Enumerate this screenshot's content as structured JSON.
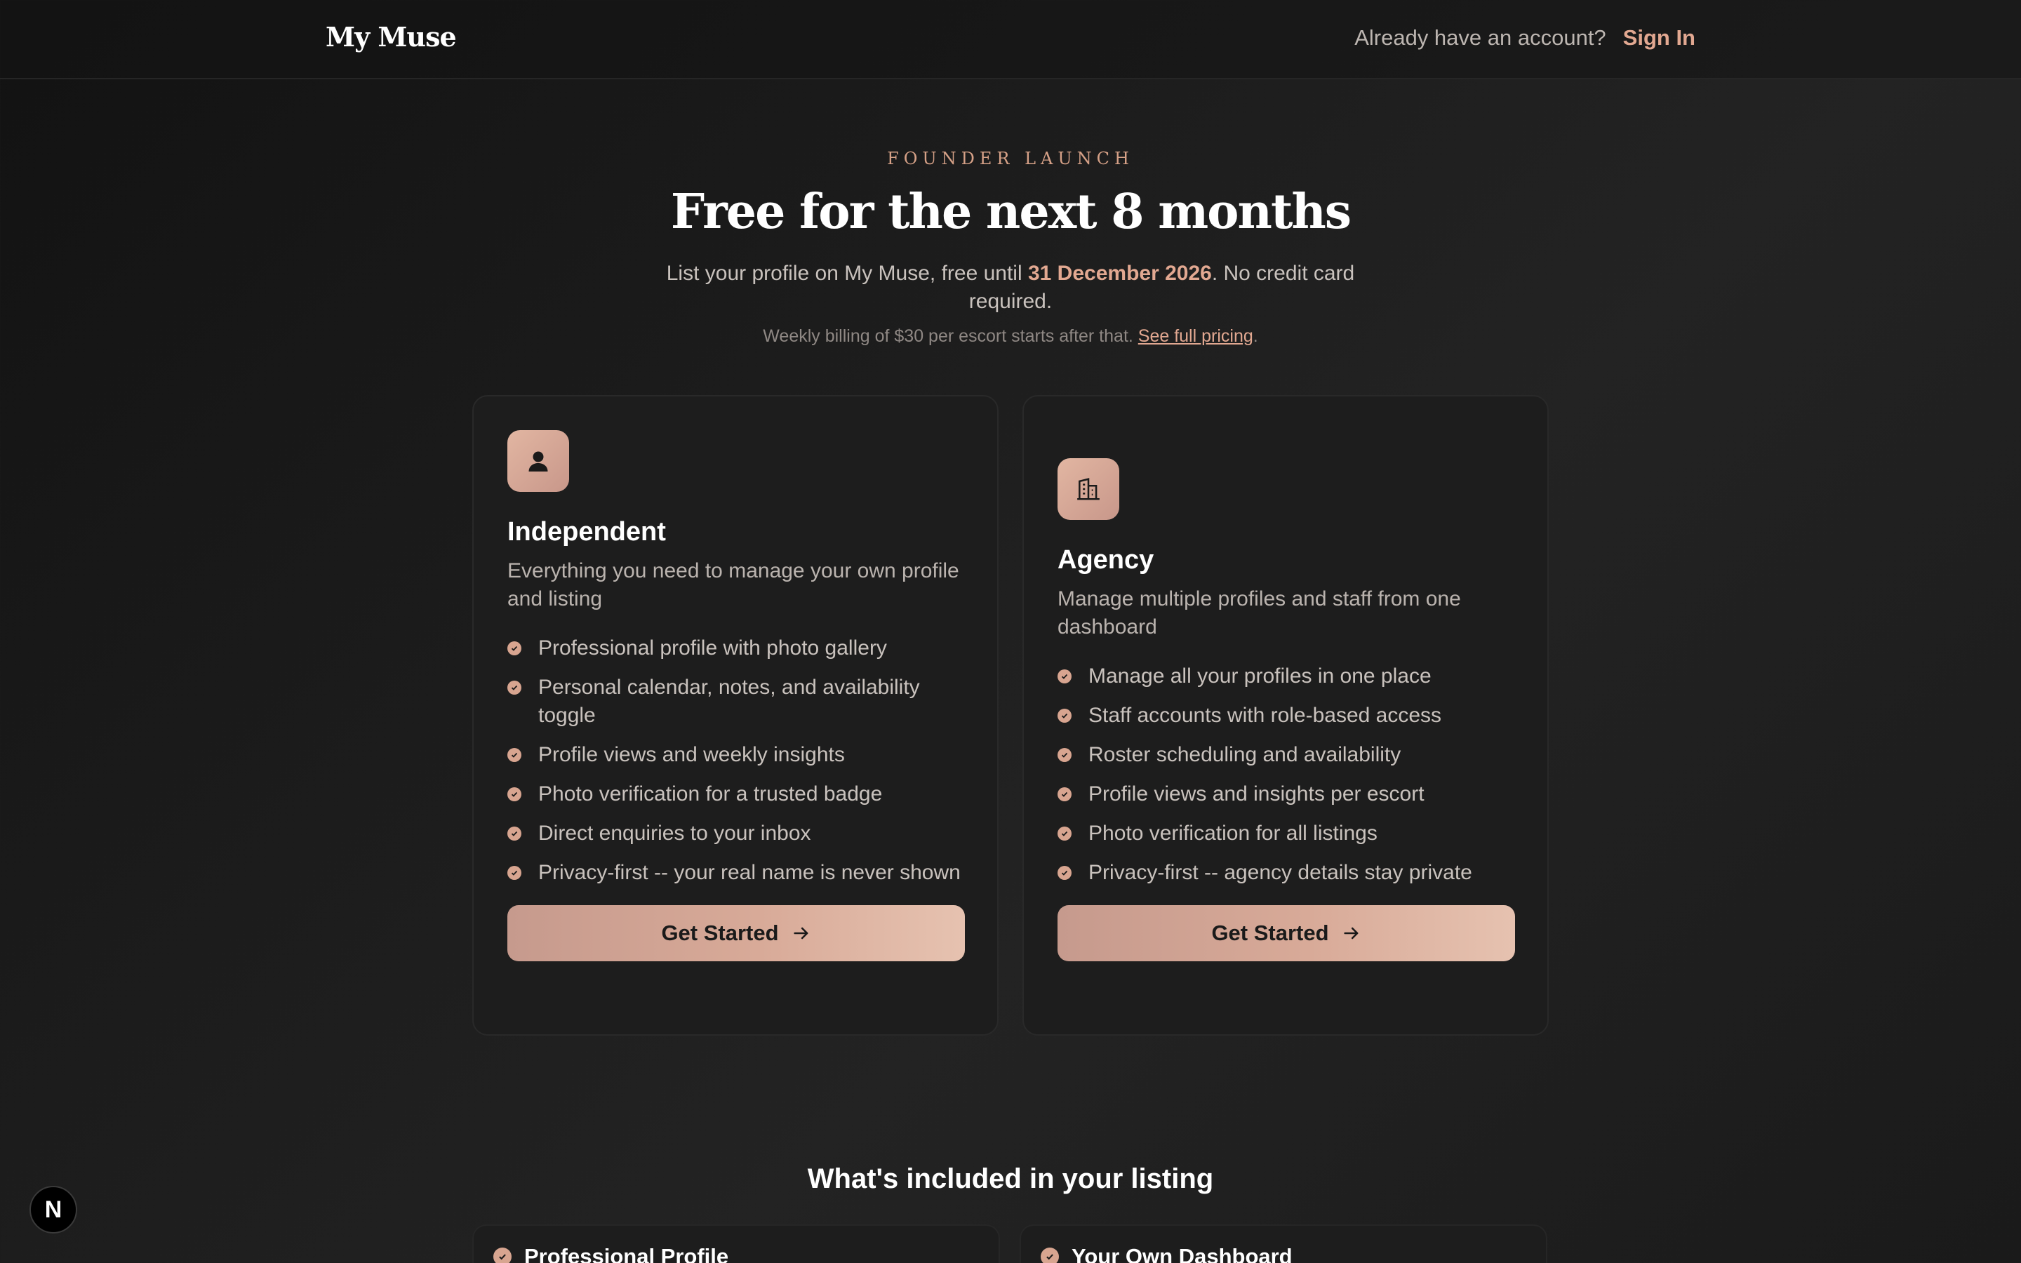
{
  "header": {
    "logo": "My Muse",
    "have_account": "Already have an account?",
    "sign_in": "Sign In"
  },
  "hero": {
    "eyebrow": "FOUNDER LAUNCH",
    "headline": "Free for the next 8 months",
    "subtitle_pre": "List your profile on My Muse, free until ",
    "subtitle_date": "31 December 2026",
    "subtitle_post": ". No credit card required.",
    "billing_text": "Weekly billing of $30 per escort starts after that. ",
    "billing_link": "See full pricing",
    "billing_end": "."
  },
  "cards": [
    {
      "icon": "user-icon",
      "title": "Independent",
      "description": "Everything you need to manage your own profile and listing",
      "features": [
        "Professional profile with photo gallery",
        "Personal calendar, notes, and availability toggle",
        "Profile views and weekly insights",
        "Photo verification for a trusted badge",
        "Direct enquiries to your inbox",
        "Privacy-first -- your real name is never shown"
      ],
      "cta": "Get Started"
    },
    {
      "icon": "building-icon",
      "title": "Agency",
      "description": "Manage multiple profiles and staff from one dashboard",
      "features": [
        "Manage all your profiles in one place",
        "Staff accounts with role-based access",
        "Roster scheduling and availability",
        "Profile views and insights per escort",
        "Photo verification for all listings",
        "Privacy-first -- agency details stay private"
      ],
      "cta": "Get Started"
    }
  ],
  "included": {
    "title": "What's included in your listing",
    "items": [
      "Professional Profile",
      "Your Own Dashboard"
    ]
  },
  "fab_label": "N",
  "colors": {
    "accent": "#e2a891",
    "background": "#1c1c1c",
    "card": "#1d1d1d"
  }
}
